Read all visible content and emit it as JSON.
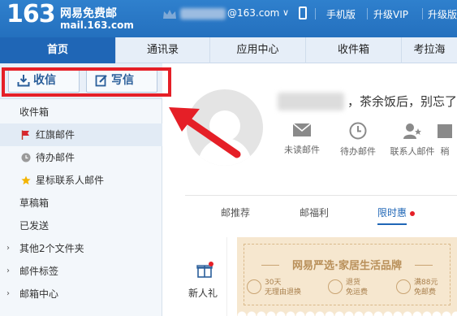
{
  "header": {
    "logo_number": "163",
    "logo_name": "网易免费邮",
    "logo_domain": "mail.163.com",
    "user_domain": "@163.com",
    "user_caret": "∨",
    "links": [
      "手机版",
      "升级VIP",
      "升级版"
    ]
  },
  "tabs": [
    {
      "label": "首页",
      "active": true
    },
    {
      "label": "通讯录",
      "active": false
    },
    {
      "label": "应用中心",
      "active": false
    },
    {
      "label": "收件箱",
      "active": false
    },
    {
      "label": "考拉海",
      "active": false
    }
  ],
  "sidebar": {
    "receive_label": "收信",
    "write_label": "写信",
    "folders": [
      {
        "label": "收件箱",
        "icon": "",
        "highlight": false,
        "arrow": false
      },
      {
        "label": "红旗邮件",
        "icon": "red-flag-icon",
        "highlight": true,
        "arrow": false
      },
      {
        "label": "待办邮件",
        "icon": "clock-icon",
        "highlight": false,
        "arrow": false
      },
      {
        "label": "星标联系人邮件",
        "icon": "star-icon",
        "highlight": false,
        "arrow": false
      },
      {
        "label": "草稿箱",
        "icon": "",
        "highlight": false,
        "arrow": false
      },
      {
        "label": "已发送",
        "icon": "",
        "highlight": false,
        "arrow": false
      },
      {
        "label": "其他2个文件夹",
        "icon": "",
        "highlight": false,
        "arrow": true
      },
      {
        "label": "邮件标签",
        "icon": "",
        "highlight": false,
        "arrow": true
      },
      {
        "label": "邮箱中心",
        "icon": "",
        "highlight": false,
        "arrow": true
      }
    ]
  },
  "main": {
    "greeting": "，茶余饭后，别忘了",
    "quick_icons": [
      {
        "label": "未读邮件",
        "icon": "envelope-icon"
      },
      {
        "label": "待办邮件",
        "icon": "clock-icon"
      },
      {
        "label": "联系人邮件",
        "icon": "contact-star-icon"
      },
      {
        "label": "稍",
        "icon": "later-icon"
      }
    ],
    "content_tabs": [
      {
        "label": "邮推荐",
        "active": false
      },
      {
        "label": "邮福利",
        "active": false
      },
      {
        "label": "限时惠",
        "active": true
      }
    ],
    "gift_label": "新人礼",
    "banner": {
      "title": "网易严选·家居生活品牌",
      "badges": [
        {
          "line1": "30天",
          "line2": "无理由退换"
        },
        {
          "line1": "退货",
          "line2": "免运费"
        },
        {
          "line1": "满88元",
          "line2": "免邮费"
        }
      ]
    }
  },
  "colors": {
    "header_blue": "#2a7ac6",
    "tab_active": "#1f66b6",
    "annotation_red": "#e51f27"
  }
}
